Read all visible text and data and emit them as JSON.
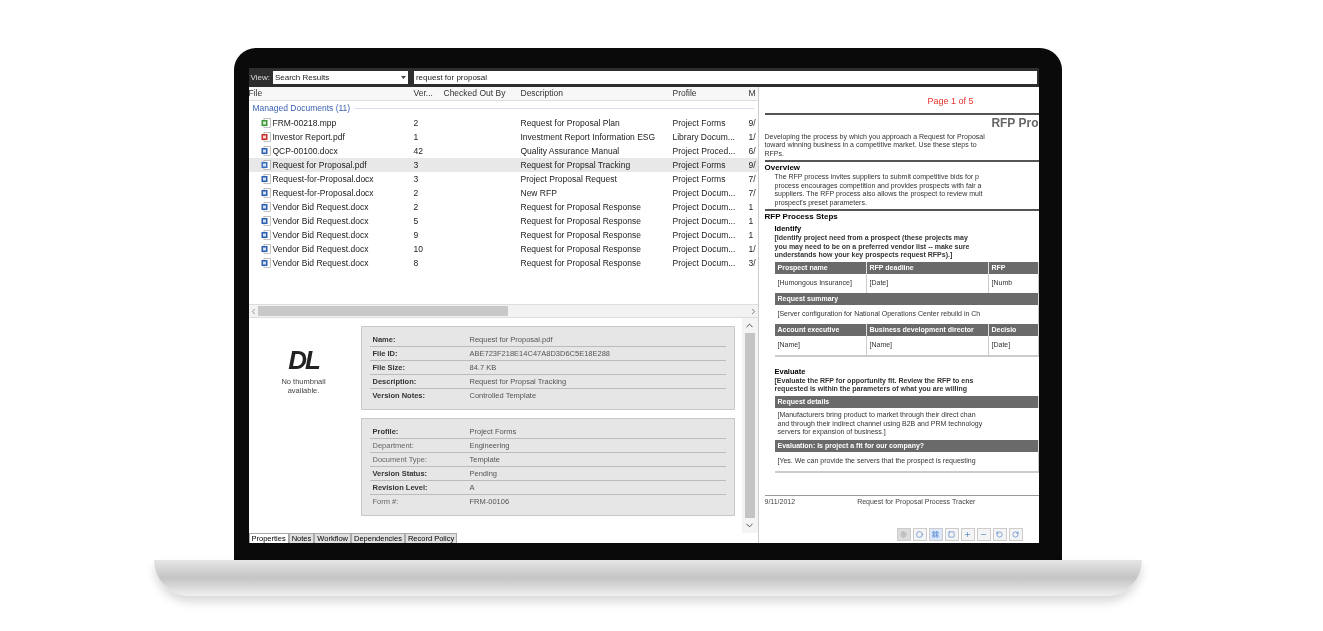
{
  "toolbar": {
    "view_label": "View:",
    "view_value": "Search Results",
    "search_value": "request for proposal"
  },
  "table": {
    "columns": [
      "File",
      "Ver...",
      "Checked Out By",
      "Description",
      "Profile",
      "M"
    ],
    "group": "Managed Documents (11)",
    "rows": [
      {
        "kind": "mpp",
        "selected": false,
        "cells": [
          "FRM-00218.mpp",
          "2",
          "",
          "Request for Proposal Plan",
          "Project Forms",
          "9/"
        ]
      },
      {
        "kind": "pdf",
        "selected": false,
        "cells": [
          "Investor Report.pdf",
          "1",
          "",
          "Investment Report Information ESG",
          "Library Docum...",
          "1/"
        ]
      },
      {
        "kind": "docx",
        "selected": false,
        "cells": [
          "QCP-00100.docx",
          "42",
          "",
          "Quality Assurance Manual",
          "Project Proced...",
          "6/"
        ]
      },
      {
        "kind": "pdf-linked",
        "selected": true,
        "cells": [
          "Request for Proposal.pdf",
          "3",
          "",
          "Request for Propsal Tracking",
          "Project Forms",
          "9/"
        ]
      },
      {
        "kind": "docx",
        "selected": false,
        "cells": [
          "Request-for-Proposal.docx",
          "3",
          "",
          "Project Proposal Request",
          "Project Forms",
          "7/"
        ]
      },
      {
        "kind": "docx",
        "selected": false,
        "cells": [
          "Request-for-Proposal.docx",
          "2",
          "",
          "New RFP",
          "Project Docum...",
          "7/"
        ]
      },
      {
        "kind": "docx",
        "selected": false,
        "cells": [
          "Vendor Bid Request.docx",
          "2",
          "",
          "Request for Proposal Response",
          "Project Docum...",
          "1"
        ]
      },
      {
        "kind": "docx",
        "selected": false,
        "cells": [
          "Vendor Bid Request.docx",
          "5",
          "",
          "Request for Proposal Response",
          "Project Docum...",
          "1"
        ]
      },
      {
        "kind": "docx",
        "selected": false,
        "cells": [
          "Vendor Bid Request.docx",
          "9",
          "",
          "Request for Proposal Response",
          "Project Docum...",
          "1"
        ]
      },
      {
        "kind": "docx",
        "selected": false,
        "cells": [
          "Vendor Bid Request.docx",
          "10",
          "",
          "Request for Proposal Response",
          "Project Docum...",
          "1/"
        ]
      },
      {
        "kind": "docx",
        "selected": false,
        "cells": [
          "Vendor Bid Request.docx",
          "8",
          "",
          "Request for Proposal Response",
          "Project Docum...",
          "3/"
        ]
      }
    ]
  },
  "details": {
    "logo": "DL",
    "thumbnail_note": "No thumbnail available.",
    "sections": [
      [
        {
          "label": "Name:",
          "value": "Request for Proposal.pdf",
          "bold": true
        },
        {
          "label": "File ID:",
          "value": "ABE723F218E14C47A8D3D6C5E18E288",
          "bold": true
        },
        {
          "label": "File Size:",
          "value": "84.7 KB",
          "bold": true
        },
        {
          "label": "Description:",
          "value": "Request for Propsal Tracking",
          "bold": true
        },
        {
          "label": "Version Notes:",
          "value": "Controlled Template",
          "bold": true
        }
      ],
      [
        {
          "label": "Profile:",
          "value": "Project Forms",
          "bold": true
        },
        {
          "label": "Department:",
          "value": "Engineering",
          "bold": false
        },
        {
          "label": "Document Type:",
          "value": "Template",
          "bold": false
        },
        {
          "label": "Version Status:",
          "value": "Pending",
          "bold": true
        },
        {
          "label": "Revision Level:",
          "value": "A",
          "bold": true
        },
        {
          "label": "Form #:",
          "value": "FRM-00106",
          "bold": false
        }
      ]
    ]
  },
  "tabs": [
    {
      "label": "Properties",
      "selected": true
    },
    {
      "label": "Notes",
      "selected": false
    },
    {
      "label": "Workflow",
      "selected": false
    },
    {
      "label": "Dependencies",
      "selected": false
    },
    {
      "label": "Record Policy",
      "selected": false
    }
  ],
  "preview": {
    "page_label": "Page 1 of 5",
    "title": "RFP Pro",
    "blocks": [
      {
        "kind": "text",
        "lines": [
          "Developing the process by which you approach a Request for Proposal",
          "toward winning business in a competitive market. Use these steps to",
          "RFPs."
        ]
      },
      {
        "kind": "heading",
        "text": "Overview"
      },
      {
        "kind": "indent",
        "lines": [
          "The RFP process invites suppliers to submit competitive bids for p",
          "process encourages competition and provides prospects with fair a",
          "suppliers. The RFP process also allows the prospect to review mult",
          "prospect's preset parameters."
        ]
      },
      {
        "kind": "heading",
        "text": "RFP Process Steps"
      },
      {
        "kind": "subheading",
        "text": "Identify"
      },
      {
        "kind": "bold",
        "lines": [
          "[Identify project need from a prospect (these projects may",
          "you may need to be on a preferred vendor list -- make sure",
          "understands how your key prospects request RFPs).]"
        ]
      },
      {
        "kind": "table",
        "rows": [
          {
            "kind": "header",
            "cells": [
              "Prospect name",
              "RFP deadline",
              "RFP"
            ]
          },
          {
            "kind": "cells",
            "cells": [
              "[Humongous Insurance]",
              "[Date]",
              "[Numb"
            ]
          },
          {
            "kind": "header",
            "cells": [
              "Request summary"
            ]
          },
          {
            "kind": "cells",
            "cells": [
              "[Server configuration for National Operations Center rebuild in Ch"
            ]
          },
          {
            "kind": "header",
            "cells": [
              "Account executive",
              "Business development director",
              "Decisio"
            ]
          },
          {
            "kind": "cells",
            "cells": [
              "[Name]",
              "[Name]",
              "[Date]"
            ]
          }
        ]
      },
      {
        "kind": "subheading",
        "text": "Evaluate"
      },
      {
        "kind": "bold",
        "lines": [
          "[Evaluate the RFP for opportunity fit. Review the RFP to ens",
          "requested is within the parameters of what you are willing"
        ]
      },
      {
        "kind": "table",
        "rows": [
          {
            "kind": "header",
            "cells": [
              "Request details"
            ]
          },
          {
            "kind": "lines",
            "lines": [
              "[Manufacturers bring product to market through their direct chan",
              "and through their indirect channel using B2B and PRM technology",
              "servers for expansion of business.]"
            ]
          },
          {
            "kind": "header",
            "cells": [
              "Evaluation: Is project a fit for our company?"
            ]
          },
          {
            "kind": "cells",
            "cells": [
              "[Yes.  We can provide the servers that the prospect is requesting"
            ]
          }
        ]
      }
    ],
    "footer": [
      "9/11/2012",
      "Request for Proposal Process Tracker"
    ]
  }
}
